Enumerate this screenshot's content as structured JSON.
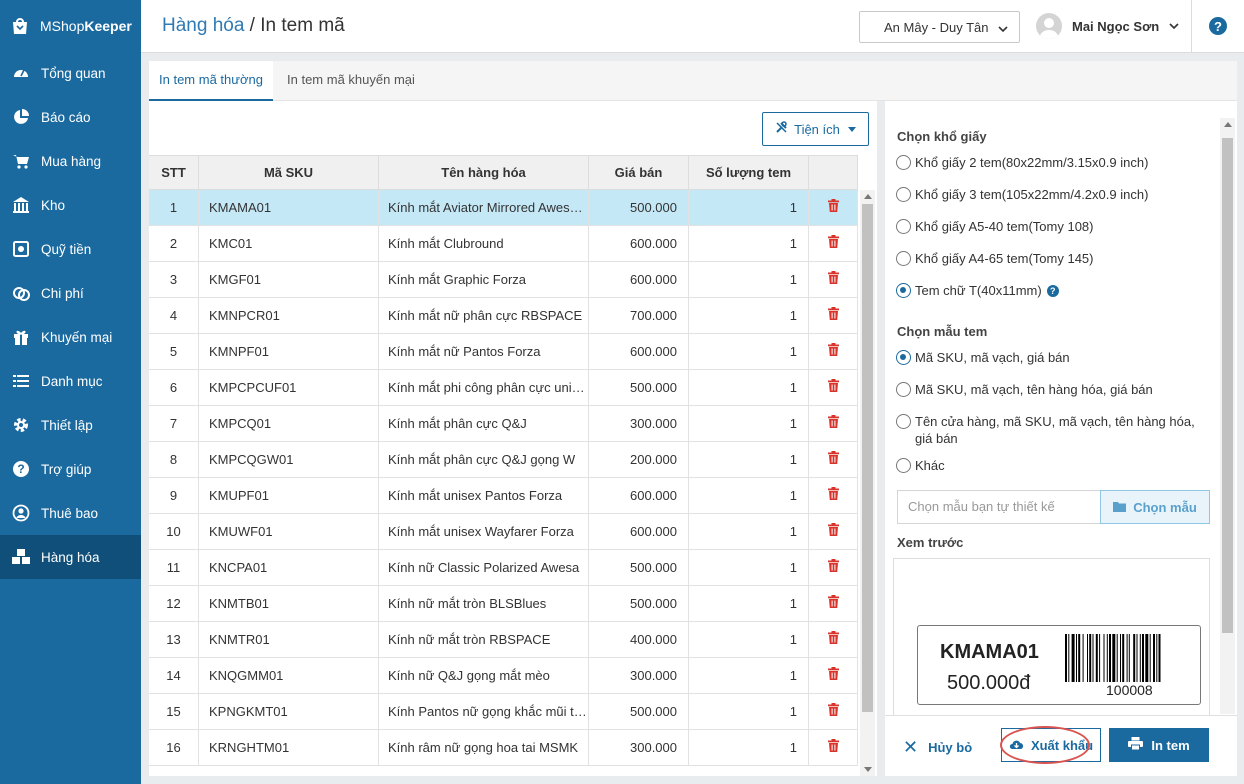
{
  "brand": {
    "name_light": "MShop",
    "name_bold": "Keeper"
  },
  "sidebar": {
    "items": [
      {
        "label": "Tổng quan",
        "icon": "dashboard-icon"
      },
      {
        "label": "Báo cáo",
        "icon": "pie-chart-icon"
      },
      {
        "label": "Mua hàng",
        "icon": "cart-icon"
      },
      {
        "label": "Kho",
        "icon": "warehouse-icon"
      },
      {
        "label": "Quỹ tiền",
        "icon": "safe-icon"
      },
      {
        "label": "Chi phí",
        "icon": "money-icon"
      },
      {
        "label": "Khuyến mại",
        "icon": "gift-icon"
      },
      {
        "label": "Danh mục",
        "icon": "list-icon"
      },
      {
        "label": "Thiết lập",
        "icon": "gear-icon"
      },
      {
        "label": "Trợ giúp",
        "icon": "question-icon"
      },
      {
        "label": "Thuê bao",
        "icon": "user-icon"
      },
      {
        "label": "Hàng hóa",
        "icon": "boxes-icon",
        "active": true
      }
    ]
  },
  "header": {
    "breadcrumb": "Hàng hóa",
    "separator": " / ",
    "title": "In tem mã",
    "store": "An Mây - Duy Tân",
    "user_name": "Mai Ngọc Sơn",
    "help": "?"
  },
  "tabs": [
    {
      "label": "In tem mã thường",
      "active": true
    },
    {
      "label": "In tem mã khuyến mại",
      "active": false
    }
  ],
  "toolbar": {
    "utilities_label": "Tiện ích"
  },
  "table": {
    "columns": [
      "STT",
      "Mã SKU",
      "Tên hàng hóa",
      "Giá bán",
      "Số lượng tem"
    ],
    "rows": [
      {
        "stt": "1",
        "sku": "KMAMA01",
        "name": "Kính mắt Aviator Mirrored Awesome",
        "price": "500.000",
        "qty": "1"
      },
      {
        "stt": "2",
        "sku": "KMC01",
        "name": "Kính mắt Clubround",
        "price": "600.000",
        "qty": "1"
      },
      {
        "stt": "3",
        "sku": "KMGF01",
        "name": "Kính mắt Graphic Forza",
        "price": "600.000",
        "qty": "1"
      },
      {
        "stt": "4",
        "sku": "KMNPCR01",
        "name": "Kính mắt nữ phân cực RBSPACE",
        "price": "700.000",
        "qty": "1"
      },
      {
        "stt": "5",
        "sku": "KMNPF01",
        "name": "Kính mắt nữ Pantos Forza",
        "price": "600.000",
        "qty": "1"
      },
      {
        "stt": "6",
        "sku": "KMPCPCUF01",
        "name": "Kính mắt phi công phân cực unisex",
        "price": "500.000",
        "qty": "1"
      },
      {
        "stt": "7",
        "sku": "KMPCQ01",
        "name": "Kính mắt phân cực Q&J",
        "price": "300.000",
        "qty": "1"
      },
      {
        "stt": "8",
        "sku": "KMPCQGW01",
        "name": "Kính mắt phân cực Q&J gọng W",
        "price": "200.000",
        "qty": "1"
      },
      {
        "stt": "9",
        "sku": "KMUPF01",
        "name": "Kính mắt unisex Pantos Forza",
        "price": "600.000",
        "qty": "1"
      },
      {
        "stt": "10",
        "sku": "KMUWF01",
        "name": "Kính mắt unisex Wayfarer Forza",
        "price": "600.000",
        "qty": "1"
      },
      {
        "stt": "11",
        "sku": "KNCPA01",
        "name": "Kính nữ Classic Polarized Awesa",
        "price": "500.000",
        "qty": "1"
      },
      {
        "stt": "12",
        "sku": "KNMTB01",
        "name": "Kính nữ mắt tròn BLSBlues",
        "price": "500.000",
        "qty": "1"
      },
      {
        "stt": "13",
        "sku": "KNMTR01",
        "name": "Kính nữ mắt tròn RBSPACE",
        "price": "400.000",
        "qty": "1"
      },
      {
        "stt": "14",
        "sku": "KNQGMM01",
        "name": "Kính nữ Q&J gọng mắt mèo",
        "price": "300.000",
        "qty": "1"
      },
      {
        "stt": "15",
        "sku": "KPNGKMT01",
        "name": "Kính Pantos nữ gọng khắc mũi tên",
        "price": "500.000",
        "qty": "1"
      },
      {
        "stt": "16",
        "sku": "KRNGHTM01",
        "name": "Kính râm nữ gọng hoa tai MSMK",
        "price": "300.000",
        "qty": "1"
      }
    ]
  },
  "paper": {
    "title": "Chọn khổ giấy",
    "options": [
      {
        "label": "Khổ giấy 2 tem(80x22mm/3.15x0.9 inch)",
        "checked": false
      },
      {
        "label": "Khổ giấy 3 tem(105x22mm/4.2x0.9 inch)",
        "checked": false
      },
      {
        "label": "Khổ giấy A5-40 tem(Tomy 108)",
        "checked": false
      },
      {
        "label": "Khổ giấy A4-65 tem(Tomy 145)",
        "checked": false
      },
      {
        "label": "Tem chữ T(40x11mm)",
        "checked": true
      }
    ]
  },
  "template": {
    "title": "Chọn mẫu tem",
    "options": [
      {
        "label": "Mã SKU, mã vạch, giá bán",
        "checked": true
      },
      {
        "label": "Mã SKU, mã vạch, tên hàng hóa, giá bán",
        "checked": false
      },
      {
        "label": "Tên cửa hàng, mã SKU, mã vạch, tên hàng hóa, giá bán",
        "checked": false
      },
      {
        "label": "Khác",
        "checked": false
      }
    ],
    "custom_placeholder": "Chọn mẫu bạn tự thiết kế",
    "choose_label": "Chọn mẫu"
  },
  "preview": {
    "title": "Xem trước",
    "sku": "KMAMA01",
    "price": "500.000đ",
    "barcode_number": "100008"
  },
  "actions": {
    "cancel": "Hủy bỏ",
    "export": "Xuất khẩu",
    "print": "In tem"
  },
  "colors": {
    "primary": "#1a6aa0",
    "delete": "#d9342b",
    "selected_row": "#c5e8f7",
    "highlight_ring": "#d9534f"
  }
}
